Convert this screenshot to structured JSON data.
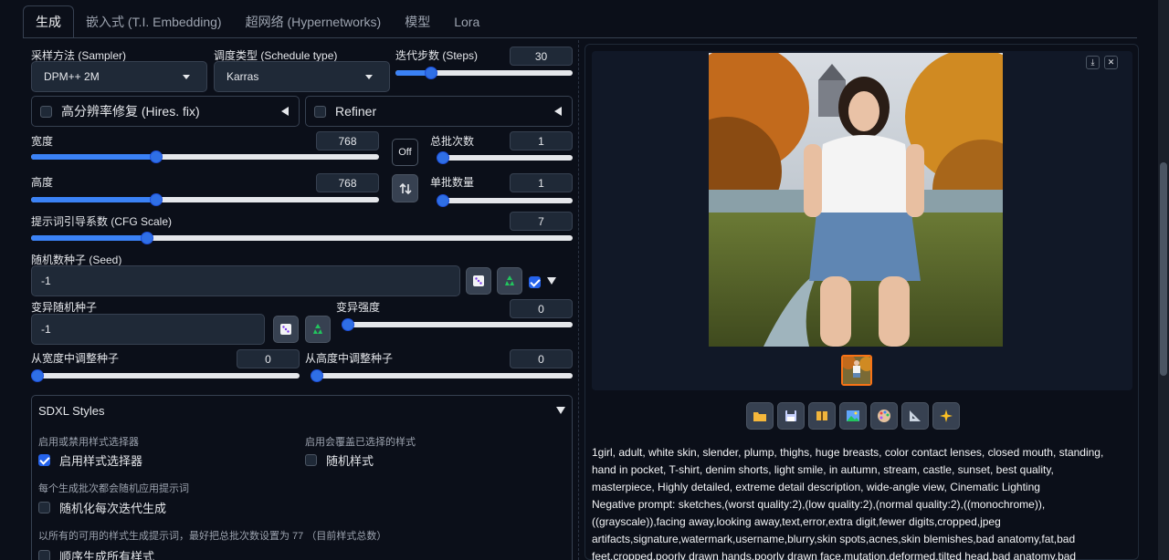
{
  "tabs": [
    "生成",
    "嵌入式 (T.I. Embedding)",
    "超网络 (Hypernetworks)",
    "模型",
    "Lora"
  ],
  "sampler": {
    "label": "采样方法 (Sampler)",
    "value": "DPM++ 2M"
  },
  "schedule": {
    "label": "调度类型 (Schedule type)",
    "value": "Karras"
  },
  "steps": {
    "label": "迭代步数 (Steps)",
    "value": "30",
    "fraction": 0.2
  },
  "hires": {
    "label": "高分辨率修复 (Hires. fix)"
  },
  "refiner": {
    "label": "Refiner"
  },
  "width": {
    "label": "宽度",
    "value": "768",
    "fraction": 0.36
  },
  "height": {
    "label": "高度",
    "value": "768",
    "fraction": 0.36
  },
  "swap_off": "Off",
  "batch_count": {
    "label": "总批次数",
    "value": "1",
    "fraction": 0.0
  },
  "batch_size": {
    "label": "单批数量",
    "value": "1",
    "fraction": 0.0
  },
  "cfg": {
    "label": "提示词引导系数 (CFG Scale)",
    "value": "7",
    "fraction": 0.214
  },
  "seed": {
    "label": "随机数种子 (Seed)",
    "value": "-1"
  },
  "var_seed": {
    "label": "变异随机种子",
    "value": "-1"
  },
  "var_strength": {
    "label": "变异强度",
    "value": "0",
    "fraction": 0.0
  },
  "resize_w": {
    "label": "从宽度中调整种子",
    "value": "0",
    "fraction": 0.0
  },
  "resize_h": {
    "label": "从高度中调整种子",
    "value": "0",
    "fraction": 0.0
  },
  "sdxl": {
    "title": "SDXL Styles",
    "enable_desc": "启用或禁用样式选择器",
    "enable_label": "启用样式选择器",
    "overwrite_desc": "启用会覆盖已选择的样式",
    "random_label": "随机样式",
    "per_batch_desc": "每个生成批次都会随机应用提示词",
    "per_iter_label": "随机化每次迭代生成",
    "all_desc": "以所有的可用的样式生成提示词，最好把总批次数设置为 77 （目前样式总数）",
    "all_label": "顺序生成所有样式"
  },
  "output": {
    "prompt": "1girl, adult, white skin, slender, plump, thighs, huge breasts, color contact lenses, closed mouth, standing, hand in pocket, T-shirt, denim shorts, light smile, in autumn, stream, castle, sunset, best quality, masterpiece, Highly detailed, extreme detail description, wide-angle view, Cinematic Lighting",
    "negative": "Negative prompt: sketches,(worst quality:2),(low quality:2),(normal quality:2),((monochrome)),((grayscale)),facing away,looking away,text,error,extra digit,fewer digits,cropped,jpeg artifacts,signature,watermark,username,blurry,skin spots,acnes,skin blemishes,bad anatomy,fat,bad feet,cropped,poorly drawn hands,poorly drawn face,mutation,deformed,tilted head,bad anatomy,bad hands,extra fingers,fewer digits,extra limbs,extra arms,extra"
  },
  "toolbar_icons": [
    "folder-icon",
    "save-icon",
    "zip-icon",
    "image-icon",
    "palette-icon",
    "ruler-icon",
    "sparkle-icon"
  ],
  "colors": {
    "accent": "#3b82f6",
    "background": "#0b0f19",
    "panel": "#1f2937",
    "border": "#374151"
  }
}
